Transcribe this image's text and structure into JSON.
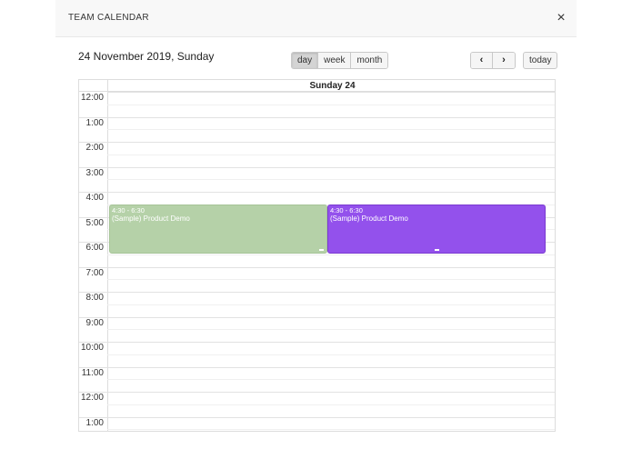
{
  "modal": {
    "title": "TEAM CALENDAR",
    "close_glyph": "×"
  },
  "header": {
    "date_title": "24 November 2019, Sunday"
  },
  "views": {
    "day": "day",
    "week": "week",
    "month": "month",
    "active": "day"
  },
  "nav": {
    "prev_glyph": "‹",
    "next_glyph": "›",
    "today": "today"
  },
  "column": {
    "title": "Sunday 24"
  },
  "time_slots": [
    "12:00",
    "1:00",
    "2:00",
    "3:00",
    "4:00",
    "5:00",
    "6:00",
    "7:00",
    "8:00",
    "9:00",
    "10:00",
    "11:00",
    "12:00",
    "1:00"
  ],
  "events": [
    {
      "time": "4:30 - 6:30",
      "title": "(Sample) Product Demo",
      "color": "#b5d1a8"
    },
    {
      "time": "4:30 - 6:30",
      "title": "(Sample) Product Demo",
      "color": "#9351ec"
    }
  ],
  "icons": {
    "close": "close-icon",
    "prev": "chevron-left-icon",
    "next": "chevron-right-icon",
    "resize": "resize-handle-icon"
  }
}
